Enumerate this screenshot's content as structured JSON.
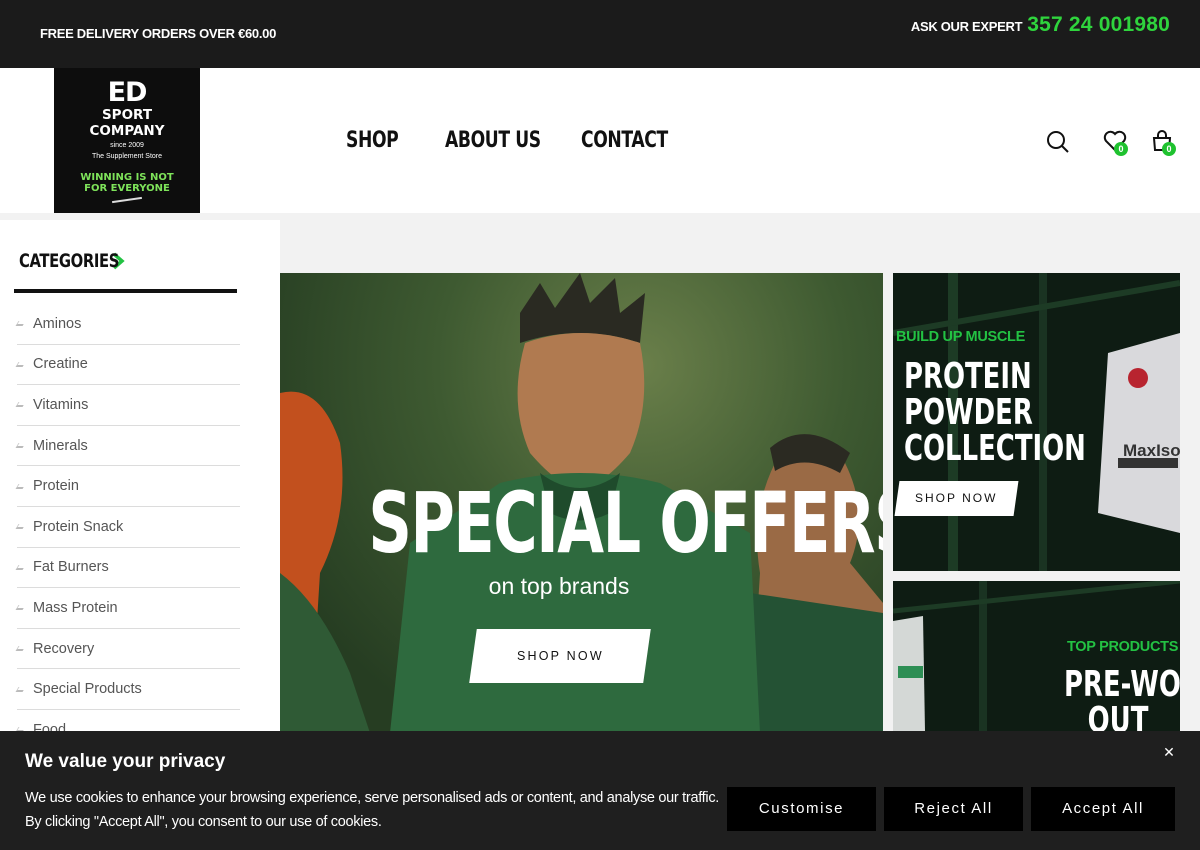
{
  "topbar": {
    "promo": "FREE DELIVERY ORDERS OVER €60.00",
    "expert_label": "ASK OUR EXPERT",
    "expert_phone": "357 24 001980"
  },
  "logo": {
    "line1": "ED",
    "line2": "SPORT",
    "line3": "COMPANY",
    "since": "since 2009",
    "store": "The Supplement Store",
    "slogan1": "WINNING IS NOT",
    "slogan2": "FOR EVERYONE"
  },
  "nav": {
    "items": [
      "SHOP",
      "ABOUT US",
      "CONTACT"
    ]
  },
  "header_icons": {
    "search": "search-icon",
    "wishlist": "heart-icon",
    "cart": "bag-icon",
    "wishlist_count": "0",
    "cart_count": "0"
  },
  "sidebar": {
    "title": "CATEGORIES",
    "items": [
      "Aminos",
      "Creatine",
      "Vitamins",
      "Minerals",
      "Protein",
      "Protein Snack",
      "Fat Burners",
      "Mass Protein",
      "Recovery",
      "Special Products",
      "Food"
    ]
  },
  "hero": {
    "title": "SPECIAL OFFERS",
    "subtitle": "on top brands",
    "button": "SHOP NOW"
  },
  "tile1": {
    "kicker": "BUILD UP MUSCLE",
    "line1": "PROTEIN",
    "line2": "POWDER",
    "line3": "COLLECTION",
    "button": "SHOP NOW",
    "product_text": "MaxIso"
  },
  "tile2": {
    "kicker": "TOP PRODUCTS",
    "line1": "PRE-WORK",
    "line2": "OUT"
  },
  "cookie": {
    "title": "We value your privacy",
    "text": "We use cookies to enhance your browsing experience, serve personalised ads or content, and analyse our traffic. By clicking \"Accept All\", you consent to our use of cookies.",
    "customise": "Customise",
    "reject": "Reject All",
    "accept": "Accept All"
  },
  "colors": {
    "accent": "#23c243",
    "topbar_bg": "#1b1b1b",
    "banner_bg": "#1f1f1f"
  }
}
